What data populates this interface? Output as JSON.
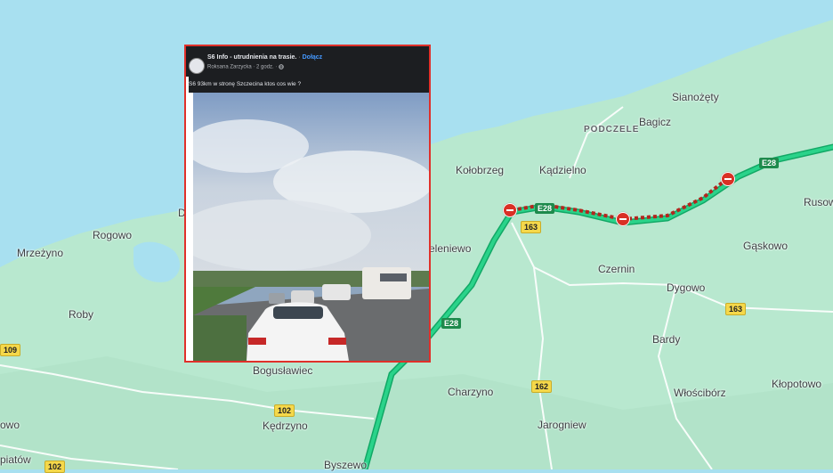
{
  "map": {
    "colors": {
      "sea": "#a8e0f0",
      "land": "#b8e8cf",
      "expressway": "#1ec27a",
      "jam": "#b3261e"
    },
    "places": [
      {
        "name": "Sianożęty",
        "style": "place"
      },
      {
        "name": "PODCZELE",
        "style": "caps"
      },
      {
        "name": "Bagicz",
        "style": "place"
      },
      {
        "name": "Kołobrzeg",
        "style": "place"
      },
      {
        "name": "Kądzielno",
        "style": "place"
      },
      {
        "name": "Rusow",
        "style": "place"
      },
      {
        "name": "Dz",
        "style": "place"
      },
      {
        "name": "Rogowo",
        "style": "place"
      },
      {
        "name": "Mrzeżyno",
        "style": "place"
      },
      {
        "name": "eleniewo",
        "style": "place"
      },
      {
        "name": "Czernin",
        "style": "place"
      },
      {
        "name": "Gąskowo",
        "style": "place"
      },
      {
        "name": "Dygowo",
        "style": "place"
      },
      {
        "name": "Roby",
        "style": "place"
      },
      {
        "name": "Bardy",
        "style": "place"
      },
      {
        "name": "Bogusławiec",
        "style": "place"
      },
      {
        "name": "Charzyno",
        "style": "place"
      },
      {
        "name": "Włościbórz",
        "style": "place"
      },
      {
        "name": "Kłopotowo",
        "style": "place"
      },
      {
        "name": "Jarogniew",
        "style": "place"
      },
      {
        "name": "Kędrzyno",
        "style": "place"
      },
      {
        "name": "Byszewo",
        "style": "place"
      },
      {
        "name": "piatów",
        "style": "place"
      },
      {
        "name": "owo",
        "style": "place"
      }
    ],
    "roads": [
      {
        "label": "E28",
        "kind": "green"
      },
      {
        "label": "E28",
        "kind": "green"
      },
      {
        "label": "E28",
        "kind": "green"
      },
      {
        "label": "163",
        "kind": "yellow"
      },
      {
        "label": "163",
        "kind": "yellow"
      },
      {
        "label": "162",
        "kind": "yellow"
      },
      {
        "label": "102",
        "kind": "yellow"
      },
      {
        "label": "102",
        "kind": "yellow"
      },
      {
        "label": "109",
        "kind": "yellow"
      }
    ],
    "closure_icons": [
      "no-entry-icon",
      "no-entry-icon",
      "no-entry-icon"
    ]
  },
  "post": {
    "group_name": "S6 Info - utrudnienia na trasie.",
    "separator": "·",
    "join_label": "Dołącz",
    "author_meta": "Roksana Zarzycka · 2 godz. · ",
    "globe_icon": "globe-icon",
    "text": "S6 93km w stronę Szczecina ktos cos wie ?"
  }
}
